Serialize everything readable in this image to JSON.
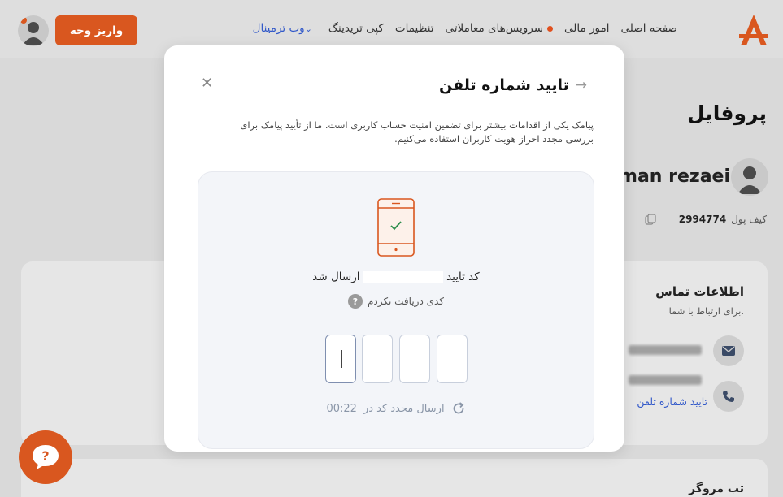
{
  "header": {
    "nav": [
      "صفحه اصلی",
      "امور مالی",
      "سرویس‌های معاملاتی",
      "تنظیمات",
      "کپی تریدینگ",
      "وب ترمینال"
    ],
    "deposit_label": "واریز وجه",
    "brand_color": "#d9571f"
  },
  "profile": {
    "title": "پروفایل",
    "user_name": "pouman rezaei",
    "wallet_label": "کیف پول",
    "wallet_number": "2994774"
  },
  "contact": {
    "title": "اطلاعات تماس",
    "subtitle": "برای ارتباط با شما.",
    "verify_phone_link": "تایید شماره تلفن"
  },
  "second_section": {
    "title": "تب مروگر"
  },
  "modal": {
    "title": "تایید شماره تلفن",
    "description": "پیامک یکی از اقدامات بیشتر برای تضمین امنیت حساب کاربری است. ما از تأیید پیامک برای بررسی مجدد احراز هویت کاربران استفاده می‌کنیم.",
    "code_sent_prefix": "کد تایید",
    "code_sent_suffix": "ارسال شد",
    "no_code_label": "کدی دریافت نکردم",
    "resend_label": "ارسال مجدد کد در",
    "resend_timer": "00:22",
    "otp_values": [
      "",
      "",
      "",
      ""
    ]
  },
  "icons": {
    "close": "close-icon",
    "back_arrow": "arrow-right-icon",
    "phone": "phone-check-icon",
    "help": "question-icon",
    "refresh": "refresh-icon",
    "mail": "mail-icon",
    "call": "phone-icon",
    "copy": "copy-icon",
    "chevron": "chevron-down-icon"
  }
}
